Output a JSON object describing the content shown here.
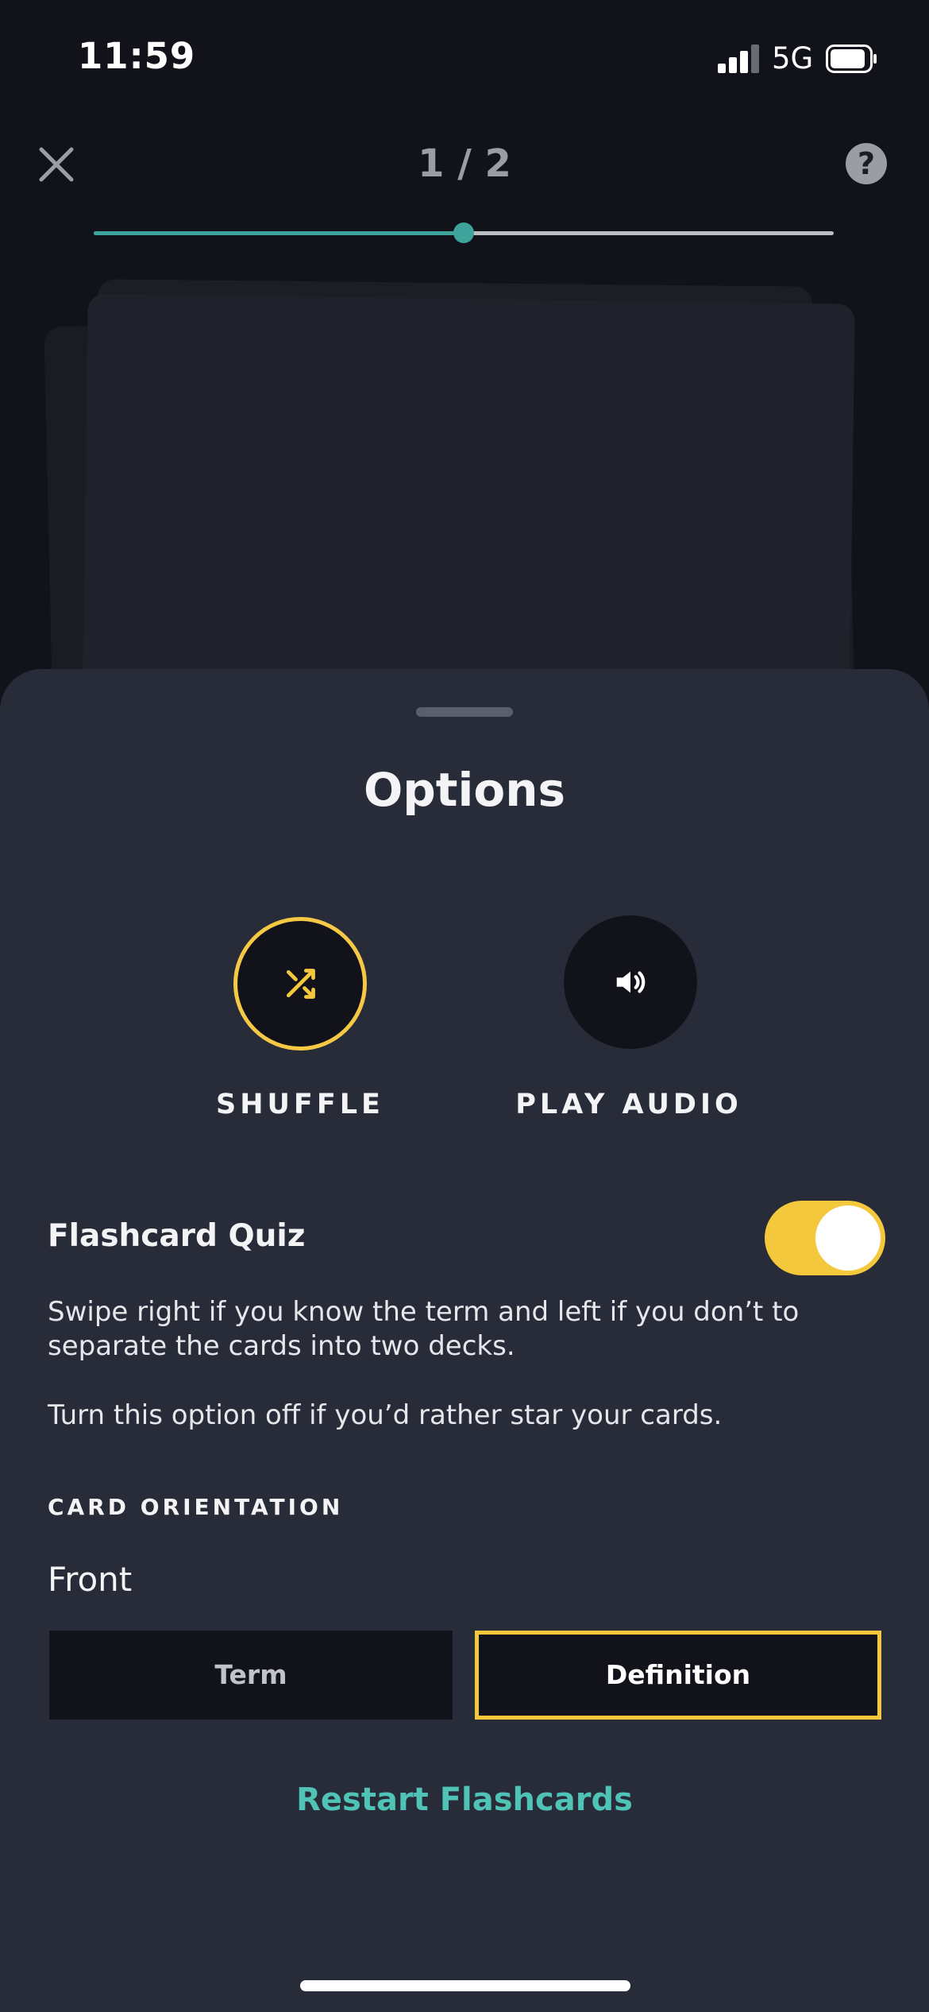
{
  "status_bar": {
    "time": "11:59",
    "network": "5G"
  },
  "top_bar": {
    "progress_text": "1 / 2",
    "help_symbol": "?",
    "close_icon": "close-icon",
    "progress_fraction": 0.5
  },
  "sheet": {
    "title": "Options",
    "options": [
      {
        "label": "SHUFFLE",
        "icon": "shuffle-icon",
        "active": true
      },
      {
        "label": "PLAY AUDIO",
        "icon": "speaker-icon",
        "active": false
      }
    ],
    "quiz": {
      "title": "Flashcard Quiz",
      "toggle_on": true,
      "description_1": "Swipe right if you know the term and left if you don’t to separate the cards into two decks.",
      "description_2": "Turn this option off if you’d rather star your cards."
    },
    "orientation": {
      "section_label": "CARD ORIENTATION",
      "front_label": "Front",
      "choices": [
        "Term",
        "Definition"
      ],
      "selected": "Definition"
    },
    "restart_label": "Restart Flashcards"
  },
  "colors": {
    "accent_yellow": "#f4c83d",
    "accent_teal": "#3ea39a",
    "link_teal": "#4fc3b6",
    "sheet_bg": "#282b38",
    "page_bg": "#12131a"
  }
}
